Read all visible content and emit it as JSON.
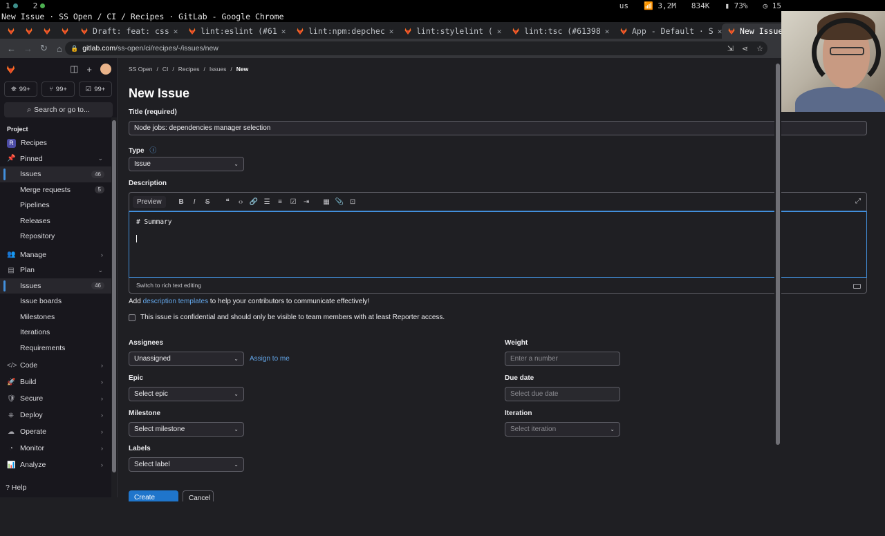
{
  "system": {
    "workspaces": [
      "1",
      "2"
    ],
    "keyboard": "us",
    "network": "3,2M",
    "traffic": "834K",
    "battery": "73%",
    "clock": "15"
  },
  "window_title": "New Issue · SS Open / CI / Recipes · GitLab - Google Chrome",
  "browser": {
    "tabs": [
      {
        "label": "",
        "kind": "small"
      },
      {
        "label": "",
        "kind": "small"
      },
      {
        "label": "",
        "kind": "small"
      },
      {
        "label": "",
        "kind": "small"
      },
      {
        "label": "Draft: feat: css",
        "kind": "mid"
      },
      {
        "label": "lint:eslint (#61",
        "kind": "mid"
      },
      {
        "label": "lint:npm:depchec",
        "kind": "mid"
      },
      {
        "label": "lint:stylelint (",
        "kind": "mid"
      },
      {
        "label": "lint:tsc (#61398",
        "kind": "mid"
      },
      {
        "label": "App - Default · S",
        "kind": "mid"
      },
      {
        "label": "New Issue",
        "kind": "active"
      }
    ],
    "url_host": "gitlab.com",
    "url_path": "/ss-open/ci/recipes/-/issues/new"
  },
  "sidebar": {
    "counters": [
      {
        "icon": "merge-request-icon",
        "value": "99+"
      },
      {
        "icon": "review-icon",
        "value": "99+"
      },
      {
        "icon": "todo-icon",
        "value": "99+"
      }
    ],
    "search_label": "Search or go to...",
    "section": "Project",
    "project_name": "Recipes",
    "project_initial": "R",
    "pinned_label": "Pinned",
    "pinned_items": [
      {
        "label": "Issues",
        "badge": "46",
        "active": true
      },
      {
        "label": "Merge requests",
        "badge": "5"
      },
      {
        "label": "Pipelines"
      },
      {
        "label": "Releases"
      },
      {
        "label": "Repository"
      }
    ],
    "manage_label": "Manage",
    "plan_label": "Plan",
    "plan_items": [
      {
        "label": "Issues",
        "badge": "46",
        "active": true
      },
      {
        "label": "Issue boards"
      },
      {
        "label": "Milestones"
      },
      {
        "label": "Iterations"
      },
      {
        "label": "Requirements"
      }
    ],
    "groups": [
      "Code",
      "Build",
      "Secure",
      "Deploy",
      "Operate",
      "Monitor",
      "Analyze"
    ],
    "help_label": "Help"
  },
  "breadcrumbs": [
    "SS Open",
    "CI",
    "Recipes",
    "Issues",
    "New"
  ],
  "page_title": "New Issue",
  "form": {
    "title_label": "Title (required)",
    "title_value": "Node jobs: dependencies manager selection",
    "type_label": "Type",
    "type_value": "Issue",
    "description_label": "Description",
    "preview_label": "Preview",
    "description_value": "# Summary",
    "rich_text_toggle": "Switch to rich text editing",
    "hint_prefix": "Add ",
    "hint_link": "description templates",
    "hint_suffix": " to help your contributors to communicate effectively!",
    "confidential_label": "This issue is confidential and should only be visible to team members with at least Reporter access.",
    "assignees_label": "Assignees",
    "assignees_value": "Unassigned",
    "assign_to_me": "Assign to me",
    "epic_label": "Epic",
    "epic_value": "Select epic",
    "milestone_label": "Milestone",
    "milestone_value": "Select milestone",
    "labels_label": "Labels",
    "labels_value": "Select label",
    "weight_label": "Weight",
    "weight_placeholder": "Enter a number",
    "due_label": "Due date",
    "due_placeholder": "Select due date",
    "iteration_label": "Iteration",
    "iteration_value": "Select iteration",
    "create_button": "Create issue",
    "cancel_button": "Cancel"
  },
  "colors": {
    "accent": "#428fdc",
    "primary_button": "#1f75cb",
    "link": "#63a6e9",
    "gitlab_orange": "#fc6d26"
  }
}
